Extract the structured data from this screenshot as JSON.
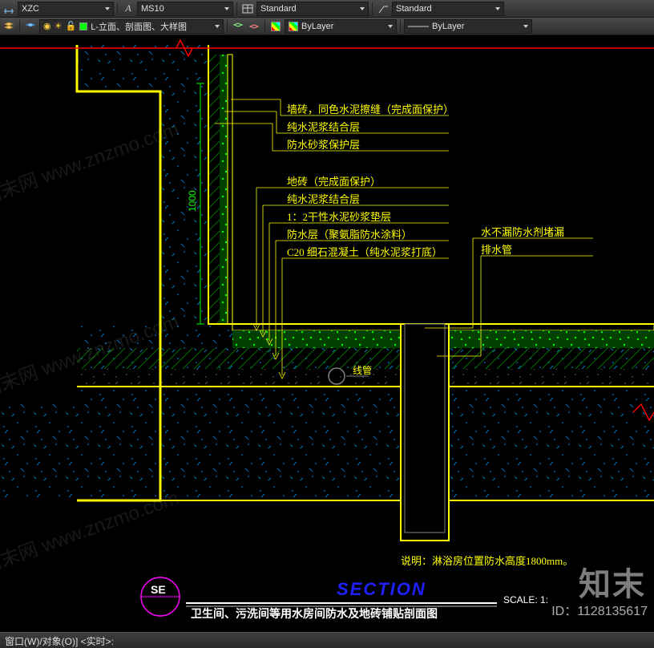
{
  "toolbar1": {
    "dim_style": "XZC",
    "text_style": "MS10",
    "table_style": "Standard",
    "mleader_style": "Standard"
  },
  "toolbar2": {
    "layer_name": "L-立面、剖面图、大样图",
    "color": "ByLayer",
    "linetype": "ByLayer"
  },
  "drawing": {
    "dim_height": "1000",
    "labels_wall": [
      "墙砖，同色水泥擦缝（完成面保护）",
      "纯水泥浆结合层",
      "防水砂浆保护层"
    ],
    "labels_floor": [
      "地砖（完成面保护）",
      "纯水泥浆结合层",
      "1：2干性水泥砂浆垫层",
      "防水层（聚氨脂防水涂料）",
      "C20 细石混凝土（纯水泥浆打底）"
    ],
    "labels_right": [
      "水不漏防水剂堵漏",
      "排水管"
    ],
    "pipe_label": "线管",
    "note": "说明：淋浴房位置防水高度1800mm。",
    "marker": "SE",
    "title_en": "SECTION",
    "title_cn": "卫生间、污洗间等用水房间防水及地砖铺贴剖面图",
    "scale_label": "SCALE: 1:",
    "watermark_text": "知末网 www.znzmo.com",
    "watermark_brand": "知末",
    "watermark_id": "ID：1128135617"
  },
  "bottom": {
    "prompt": "窗口(W)/对象(O)] <实时>:"
  }
}
